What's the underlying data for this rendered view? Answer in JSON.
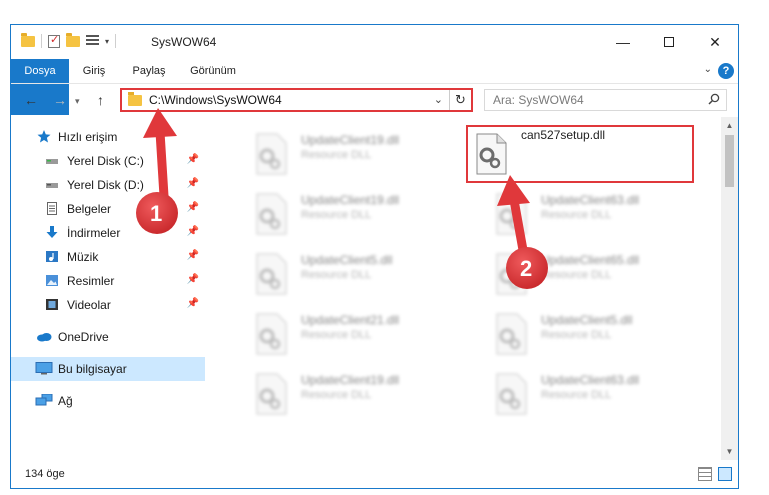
{
  "window": {
    "title": "SysWOW64",
    "minimize_glyph": "—",
    "close_glyph": "✕"
  },
  "ribbon": {
    "tabs": [
      {
        "label": "Dosya"
      },
      {
        "label": "Giriş"
      },
      {
        "label": "Paylaş"
      },
      {
        "label": "Görünüm"
      }
    ],
    "help_glyph": "?"
  },
  "addressbar": {
    "path": "C:\\Windows\\SysWOW64",
    "search_placeholder": "Ara: SysWOW64"
  },
  "navpane": {
    "items": [
      {
        "label": "Hızlı erişim",
        "icon": "star-icon",
        "pinned": false
      },
      {
        "label": "Yerel Disk (C:)",
        "icon": "drive-icon",
        "pinned": true
      },
      {
        "label": "Yerel Disk (D:)",
        "icon": "drive-icon",
        "pinned": true
      },
      {
        "label": "Belgeler",
        "icon": "document-icon",
        "pinned": true
      },
      {
        "label": "İndirmeler",
        "icon": "download-icon",
        "pinned": true
      },
      {
        "label": "Müzik",
        "icon": "music-icon",
        "pinned": true
      },
      {
        "label": "Resimler",
        "icon": "pictures-icon",
        "pinned": true
      },
      {
        "label": "Videolar",
        "icon": "video-icon",
        "pinned": true
      },
      {
        "label": "OneDrive",
        "icon": "cloud-icon",
        "pinned": false
      },
      {
        "label": "Bu bilgisayar",
        "icon": "computer-icon",
        "pinned": false,
        "selected": true
      },
      {
        "label": "Ağ",
        "icon": "network-icon",
        "pinned": false
      }
    ]
  },
  "files": [
    {
      "name": "UpdateClient19.dll",
      "type": "Resource DLL",
      "blurred": true
    },
    {
      "name": "can527setup.dll",
      "type": "",
      "blurred": false,
      "highlighted": true
    },
    {
      "name": "UpdateClient19.dll",
      "type": "Resource DLL",
      "blurred": true
    },
    {
      "name": "UpdateClient63.dll",
      "type": "Resource DLL",
      "blurred": true
    },
    {
      "name": "UpdateClient5.dll",
      "type": "Resource DLL",
      "blurred": true
    },
    {
      "name": "UpdateClient65.dll",
      "type": "Resource DLL",
      "blurred": true
    },
    {
      "name": "UpdateClient21.dll",
      "type": "Resource DLL",
      "blurred": true
    },
    {
      "name": "UpdateClient5.dll",
      "type": "Resource DLL",
      "blurred": true
    },
    {
      "name": "UpdateClient19.dll",
      "type": "Resource DLL",
      "blurred": true
    },
    {
      "name": "UpdateClient63.dll",
      "type": "Resource DLL",
      "blurred": true
    }
  ],
  "statusbar": {
    "count": "134 öge"
  },
  "annotations": {
    "badge_1": "1",
    "badge_2": "2",
    "color": "#e0383b"
  }
}
